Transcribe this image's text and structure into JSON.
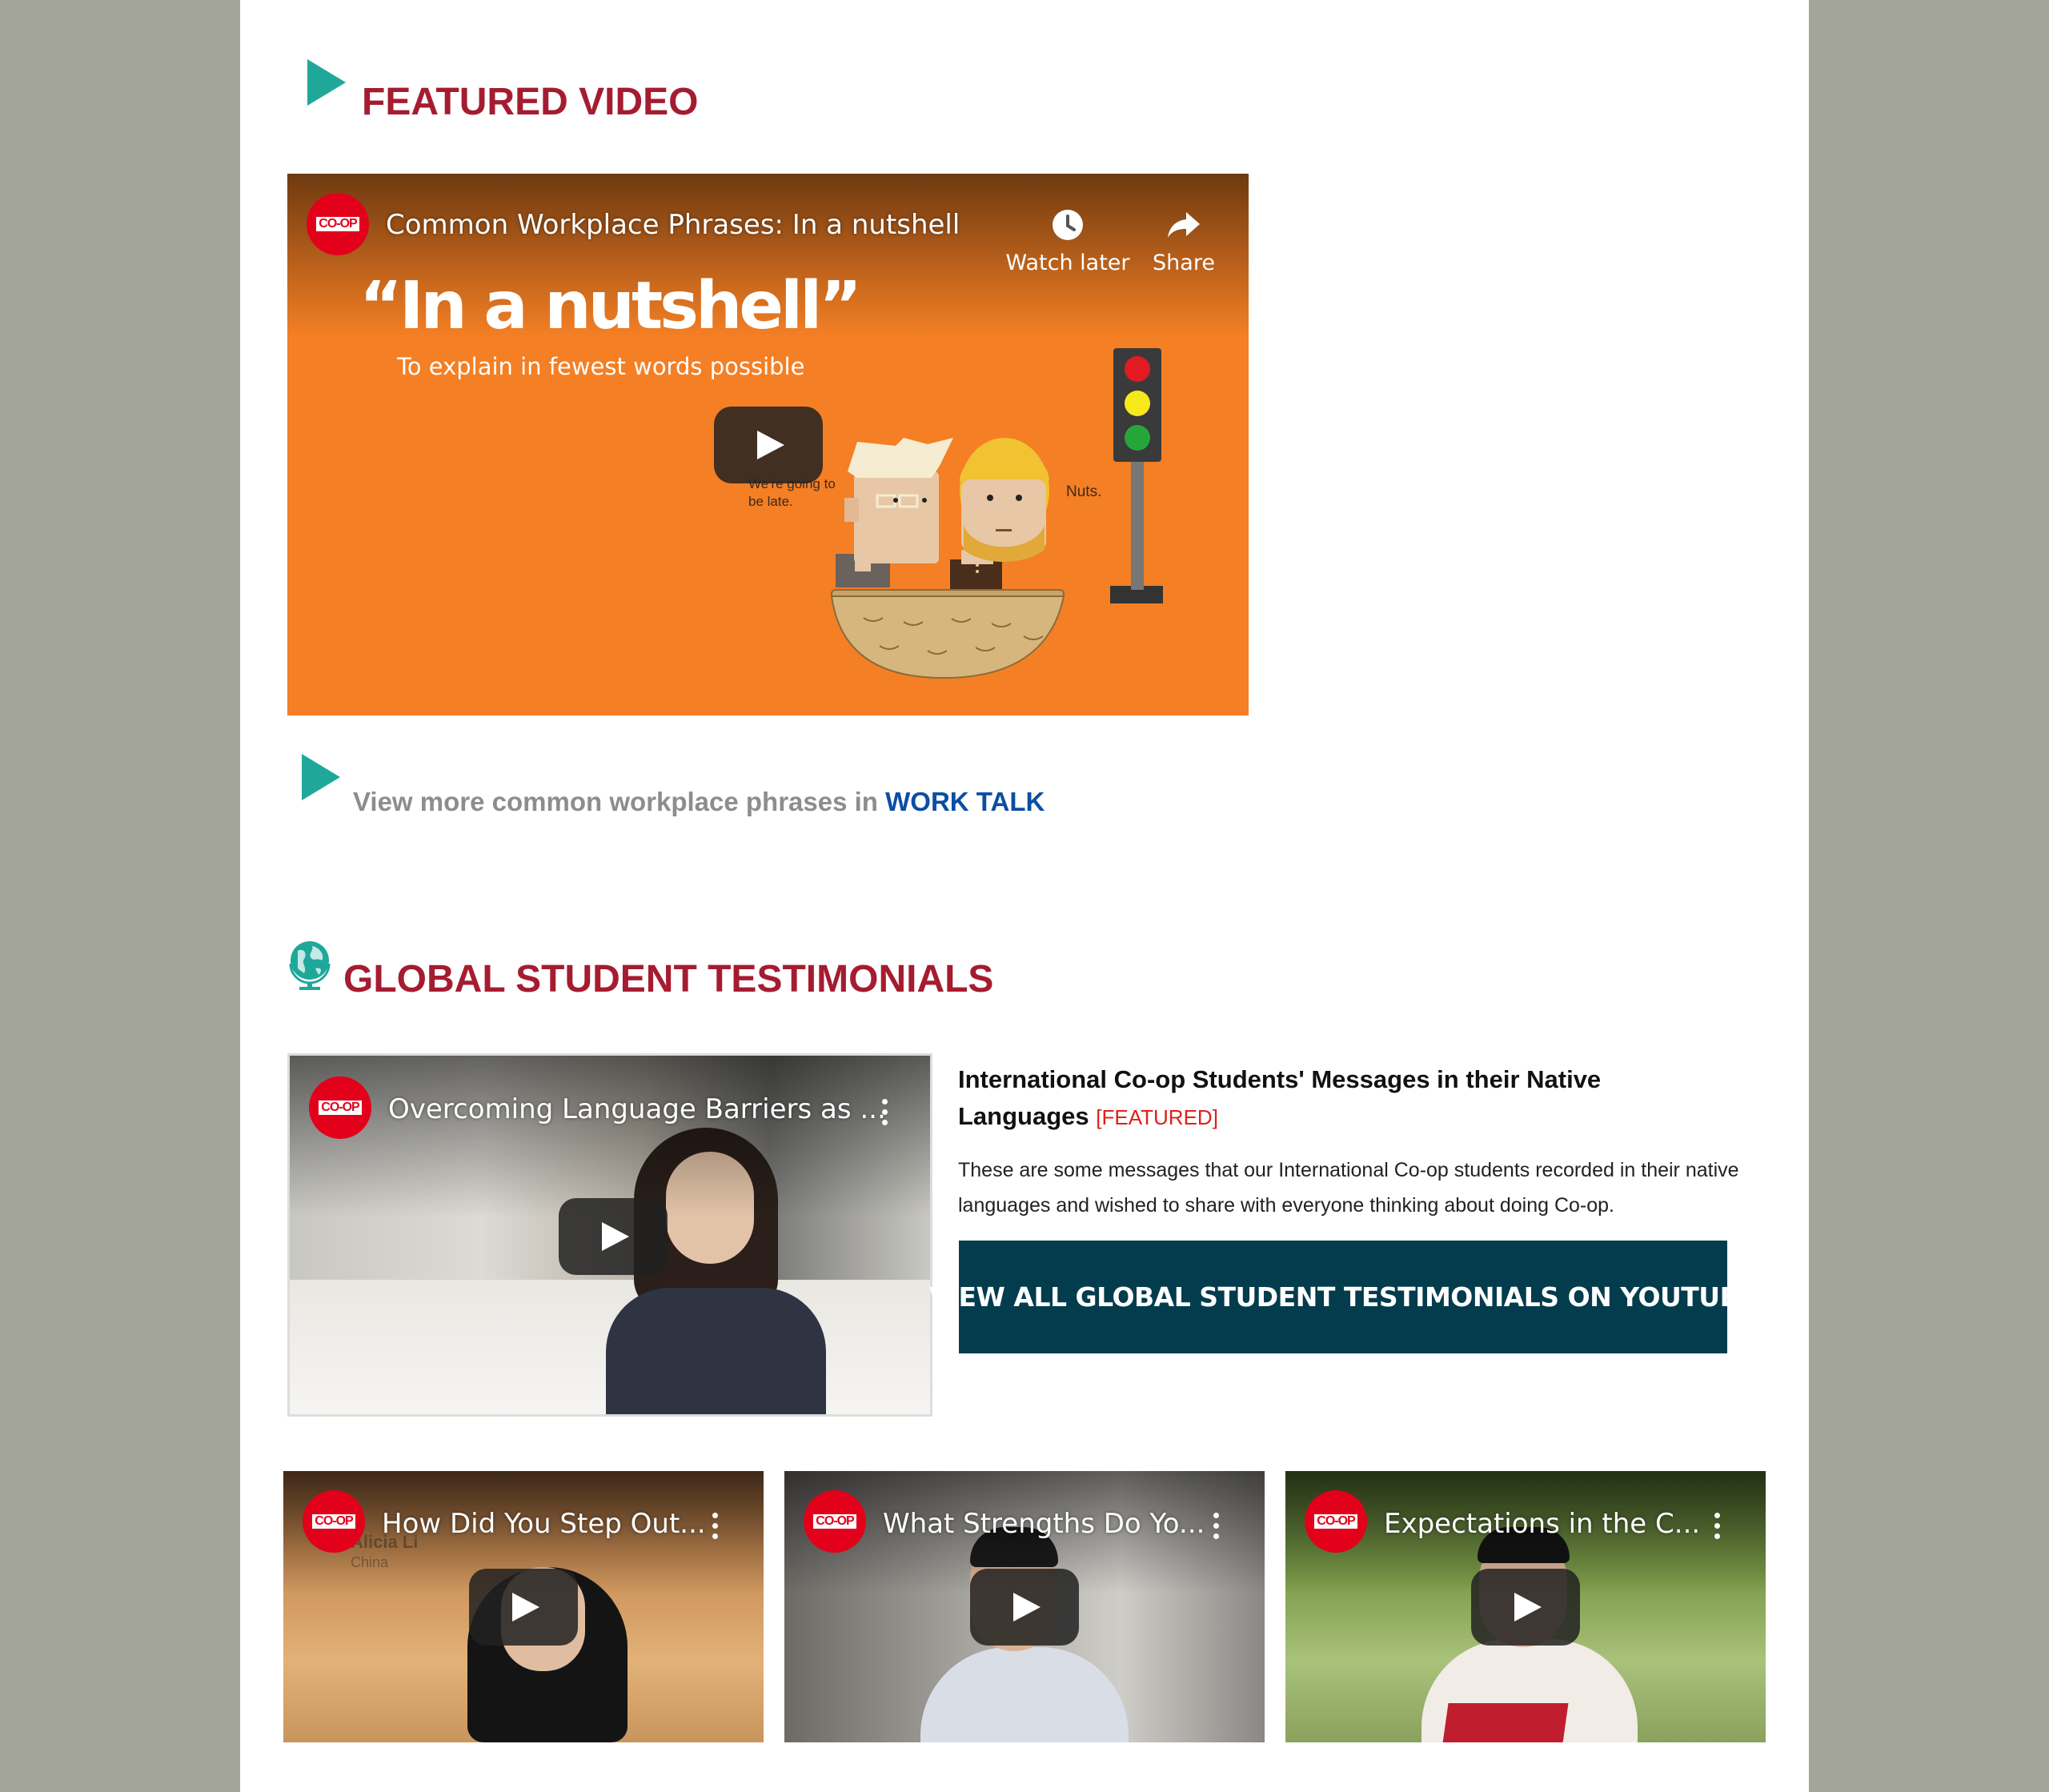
{
  "featured": {
    "title": "FEATURED VIDEO",
    "video": {
      "channel_logo": "CO-OP",
      "title": "Common Workplace Phrases: In a nutshell",
      "watch_later_label": "Watch later",
      "share_label": "Share",
      "headline": "“In a nutshell”",
      "subline": "To explain in fewest words possible",
      "speech_left": "We're going to be late.",
      "speech_right": "Nuts."
    },
    "more_prefix": "View more common workplace phrases in",
    "more_link": "WORK TALK"
  },
  "testimonials": {
    "title": "GLOBAL STUDENT TESTIMONIALS",
    "main_video": {
      "channel_logo": "CO-OP",
      "title": "Overcoming Language Barriers as ..."
    },
    "article_title": "International Co-op Students' Messages in their Native Languages",
    "featured_tag": "[FEATURED]",
    "description": "These are some messages that our International Co-op students recorded in their native languages and wished to share with everyone thinking about doing Co-op.",
    "cta_label": "VIEW ALL GLOBAL STUDENT TESTIMONIALS ON YOUTUBE",
    "videos": [
      {
        "channel_logo": "CO-OP",
        "title": "How Did You Step Out...",
        "caption_name": "Alicia Li",
        "caption_place": "China"
      },
      {
        "channel_logo": "CO-OP",
        "title": "What Strengths Do Yo..."
      },
      {
        "channel_logo": "CO-OP",
        "title": "Expectations in the C..."
      }
    ]
  },
  "colors": {
    "accent_red": "#a51c30",
    "teal_icon": "#1fa89a",
    "link_blue": "#0b4ea2",
    "cta_bg": "#033c4d",
    "video_orange": "#f47f24"
  },
  "icons": [
    "play-arrow-icon",
    "globe-icon",
    "clock-icon",
    "share-icon",
    "youtube-play-icon",
    "more-vert-icon"
  ]
}
